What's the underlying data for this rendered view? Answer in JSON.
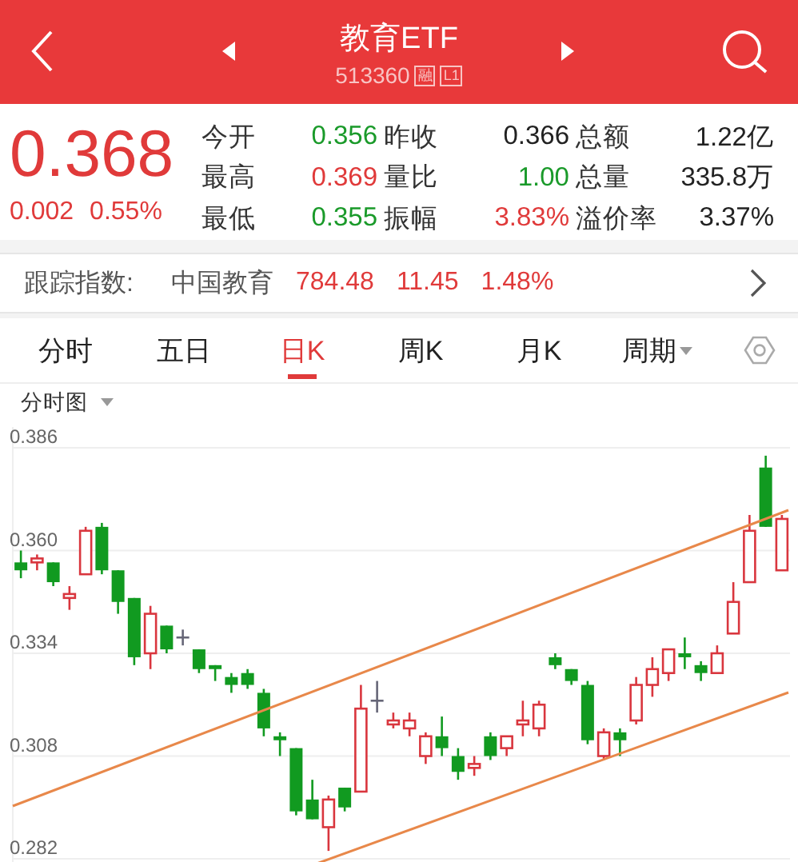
{
  "header": {
    "title": "教育ETF",
    "code": "513360",
    "badges": [
      "融",
      "L1"
    ]
  },
  "quote": {
    "price": "0.368",
    "change": "0.002",
    "change_pct": "0.55%",
    "kind": "up",
    "stats": [
      {
        "label": "今开",
        "value": "0.356",
        "kind": "down"
      },
      {
        "label": "昨收",
        "value": "0.366",
        "kind": "flat"
      },
      {
        "label": "总额",
        "value": "1.22亿",
        "kind": "flat"
      },
      {
        "label": "最高",
        "value": "0.369",
        "kind": "up"
      },
      {
        "label": "量比",
        "value": "1.00",
        "kind": "down"
      },
      {
        "label": "总量",
        "value": "335.8万",
        "kind": "flat"
      },
      {
        "label": "最低",
        "value": "0.355",
        "kind": "down"
      },
      {
        "label": "振幅",
        "value": "3.83%",
        "kind": "up"
      },
      {
        "label": "溢价率",
        "value": "3.37%",
        "kind": "flat"
      }
    ]
  },
  "index_bar": {
    "label": "跟踪指数:",
    "name": "中国教育",
    "value": "784.48",
    "change": "11.45",
    "change_pct": "1.48%",
    "kind": "up"
  },
  "tabs": [
    {
      "label": "分时",
      "kind": "plain",
      "selected": false
    },
    {
      "label": "五日",
      "kind": "plain",
      "selected": false
    },
    {
      "label": "日K",
      "kind": "plain",
      "selected": true
    },
    {
      "label": "周K",
      "kind": "plain",
      "selected": false
    },
    {
      "label": "月K",
      "kind": "plain",
      "selected": false
    },
    {
      "label": "周期",
      "kind": "dropdown",
      "selected": false
    }
  ],
  "chart": {
    "mode": "分时图",
    "chart_data": {
      "type": "candlestick",
      "ohlc": [
        [
          0.357,
          0.36,
          0.353,
          0.355
        ],
        [
          0.357,
          0.359,
          0.355,
          0.358
        ],
        [
          0.357,
          0.357,
          0.351,
          0.352
        ],
        [
          0.348,
          0.351,
          0.345,
          0.349
        ],
        [
          0.354,
          0.366,
          0.354,
          0.365
        ],
        [
          0.366,
          0.367,
          0.354,
          0.355
        ],
        [
          0.355,
          0.355,
          0.344,
          0.347
        ],
        [
          0.348,
          0.348,
          0.331,
          0.333
        ],
        [
          0.334,
          0.346,
          0.33,
          0.344
        ],
        [
          0.341,
          0.341,
          0.334,
          0.335
        ],
        [
          0.338,
          0.34,
          0.336,
          0.338
        ],
        [
          0.335,
          0.335,
          0.329,
          0.33
        ],
        [
          0.331,
          0.331,
          0.327,
          0.33
        ],
        [
          0.328,
          0.329,
          0.324,
          0.326
        ],
        [
          0.329,
          0.33,
          0.325,
          0.326
        ],
        [
          0.324,
          0.325,
          0.313,
          0.315
        ],
        [
          0.313,
          0.314,
          0.308,
          0.312
        ],
        [
          0.31,
          0.31,
          0.293,
          0.294
        ],
        [
          0.297,
          0.302,
          0.292,
          0.292
        ],
        [
          0.29,
          0.298,
          0.284,
          0.297
        ],
        [
          0.3,
          0.3,
          0.294,
          0.295
        ],
        [
          0.299,
          0.326,
          0.299,
          0.32
        ],
        [
          0.322,
          0.327,
          0.319,
          0.322
        ],
        [
          0.316,
          0.319,
          0.315,
          0.317
        ],
        [
          0.315,
          0.319,
          0.313,
          0.317
        ],
        [
          0.308,
          0.314,
          0.306,
          0.313
        ],
        [
          0.313,
          0.318,
          0.308,
          0.31
        ],
        [
          0.308,
          0.31,
          0.302,
          0.304
        ],
        [
          0.305,
          0.308,
          0.303,
          0.306
        ],
        [
          0.313,
          0.314,
          0.307,
          0.308
        ],
        [
          0.31,
          0.313,
          0.308,
          0.313
        ],
        [
          0.316,
          0.322,
          0.313,
          0.317
        ],
        [
          0.315,
          0.322,
          0.313,
          0.321
        ],
        [
          0.333,
          0.334,
          0.33,
          0.331
        ],
        [
          0.33,
          0.33,
          0.326,
          0.327
        ],
        [
          0.326,
          0.327,
          0.311,
          0.312
        ],
        [
          0.308,
          0.315,
          0.307,
          0.314
        ],
        [
          0.314,
          0.315,
          0.308,
          0.312
        ],
        [
          0.317,
          0.328,
          0.316,
          0.326
        ],
        [
          0.326,
          0.333,
          0.323,
          0.33
        ],
        [
          0.329,
          0.335,
          0.327,
          0.335
        ],
        [
          0.334,
          0.338,
          0.33,
          0.333
        ],
        [
          0.331,
          0.332,
          0.327,
          0.329
        ],
        [
          0.329,
          0.336,
          0.329,
          0.334
        ],
        [
          0.339,
          0.352,
          0.339,
          0.347
        ],
        [
          0.352,
          0.369,
          0.352,
          0.365
        ],
        [
          0.381,
          0.384,
          0.366,
          0.366
        ],
        [
          0.355,
          0.369,
          0.355,
          0.368
        ]
      ],
      "grid": true,
      "ylim": [
        0.282,
        0.386
      ],
      "yticks": [
        {
          "value": 0.386,
          "label": "0.386"
        },
        {
          "value": 0.36,
          "label": "0.360"
        },
        {
          "value": 0.334,
          "label": "0.334"
        },
        {
          "value": 0.308,
          "label": "0.308"
        },
        {
          "value": 0.282,
          "label": "0.282"
        }
      ]
    }
  }
}
